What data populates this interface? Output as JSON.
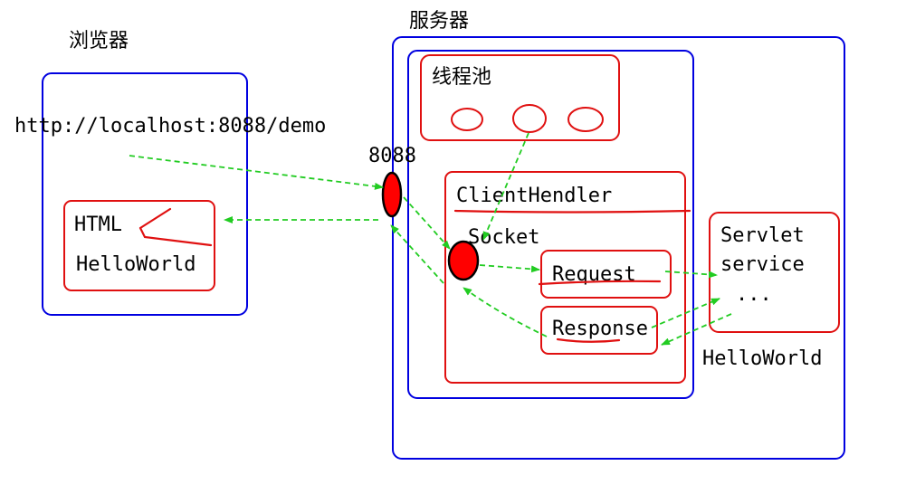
{
  "browser": {
    "title": "浏览器",
    "url": "http://localhost:8088/demo",
    "html_label": "HTML",
    "helloworld_label": "HelloWorld"
  },
  "server": {
    "title": "服务器",
    "port_label": "8088",
    "thread_pool_label": "线程池",
    "client_handler_label": "ClientHendler",
    "socket_label": "Socket",
    "request_label": "Request",
    "response_label": "Response",
    "servlet_line1": "Servlet",
    "servlet_line2": "service",
    "servlet_line3": "...",
    "helloworld_label": "HelloWorld"
  },
  "colors": {
    "container_border": "#0000e0",
    "component_border": "#e01010",
    "socket_fill": "#ff0000",
    "flow_arrow": "#22cc22",
    "annotation": "#e01010"
  }
}
